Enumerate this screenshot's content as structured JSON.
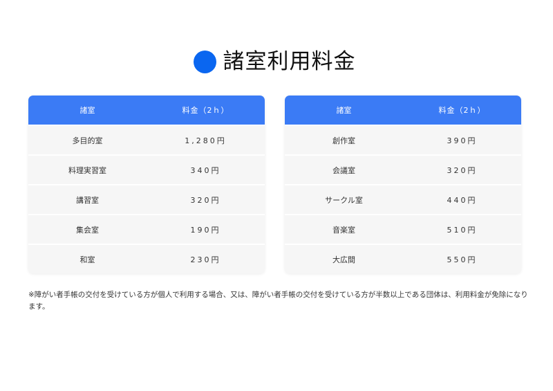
{
  "title": "諸室利用料金",
  "colors": {
    "accent": "#0a66f0",
    "header_bg": "#3b7bf5",
    "row_bg": "#f6f6f6"
  },
  "tables": [
    {
      "headers": {
        "room": "諸室",
        "fee": "料金（2ｈ）"
      },
      "rows": [
        {
          "room": "多目的室",
          "fee": "1,280円"
        },
        {
          "room": "料理実習室",
          "fee": "340円"
        },
        {
          "room": "講習室",
          "fee": "320円"
        },
        {
          "room": "集会室",
          "fee": "190円"
        },
        {
          "room": "和室",
          "fee": "230円"
        }
      ]
    },
    {
      "headers": {
        "room": "諸室",
        "fee": "料金（2ｈ）"
      },
      "rows": [
        {
          "room": "創作室",
          "fee": "390円"
        },
        {
          "room": "会議室",
          "fee": "320円"
        },
        {
          "room": "サークル室",
          "fee": "440円"
        },
        {
          "room": "音楽室",
          "fee": "510円"
        },
        {
          "room": "大広間",
          "fee": "550円"
        }
      ]
    }
  ],
  "note": "※障がい者手帳の交付を受けている方が個人で利用する場合、又は、障がい者手帳の交付を受けている方が半数以上である団体は、利用料金が免除になります。"
}
